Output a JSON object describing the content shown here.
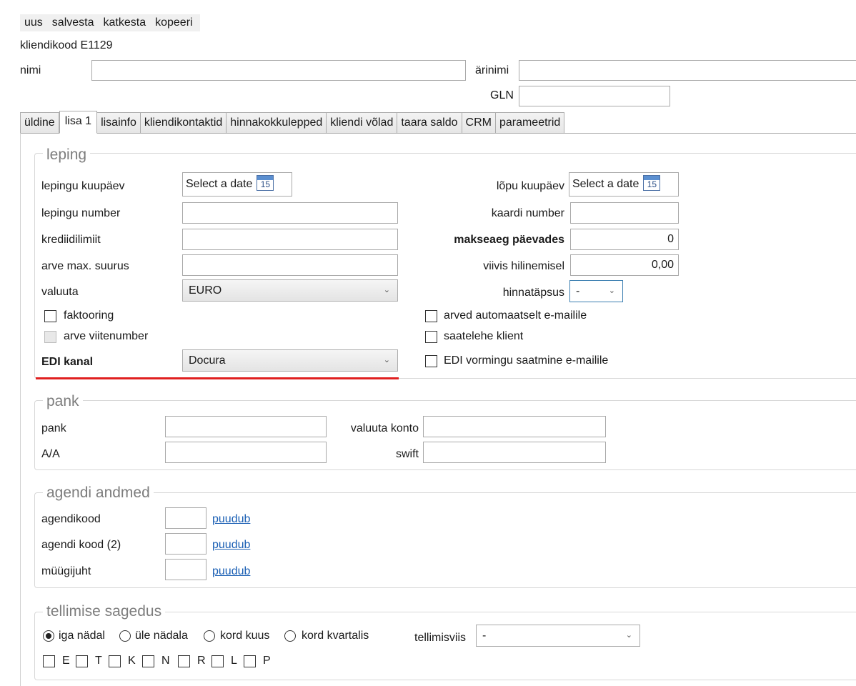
{
  "menu": {
    "new": "uus",
    "save": "salvesta",
    "cancel": "katkesta",
    "copy": "kopeeri"
  },
  "header": {
    "client_code": "kliendikood E1129",
    "name_label": "nimi",
    "name_value": "",
    "business_name_label": "ärinimi",
    "business_name_value": "",
    "gln_label": "GLN",
    "gln_value": ""
  },
  "tabs": [
    "üldine",
    "lisa 1",
    "lisainfo",
    "kliendikontaktid",
    "hinnakokkulepped",
    "kliendi võlad",
    "taara saldo",
    "CRM",
    "parameetrid"
  ],
  "active_tab": "lisa 1",
  "contract": {
    "legend": "leping",
    "start_date_label": "lepingu kuupäev",
    "start_date_placeholder": "Select a date",
    "calendar_day": "15",
    "end_date_label": "lõpu kuupäev",
    "end_date_placeholder": "Select a date",
    "number_label": "lepingu number",
    "number_value": "",
    "card_label": "kaardi number",
    "card_value": "",
    "credit_label": "krediidilimiit",
    "credit_value": "",
    "payment_days_label": "makseaeg päevades",
    "payment_days_value": "0",
    "max_invoice_label": "arve max. suurus",
    "max_invoice_value": "",
    "penalty_label": "viivis hilinemisel",
    "penalty_value": "0,00",
    "currency_label": "valuuta",
    "currency_value": "EURO",
    "price_precision_label": "hinnatäpsus",
    "price_precision_value": "-",
    "factoring_label": "faktooring",
    "invoice_ref_label": "arve viitenumber",
    "auto_email_label": "arved automaatselt e-mailile",
    "waybill_label": "saatelehe klient",
    "edi_label": "EDI kanal",
    "edi_value": "Docura",
    "edi_email_label": "EDI vormingu saatmine e-mailile"
  },
  "bank": {
    "legend": "pank",
    "bank_label": "pank",
    "bank_value": "",
    "currency_account_label": "valuuta konto",
    "currency_account_value": "",
    "account_label": "A/A",
    "account_value": "",
    "swift_label": "swift",
    "swift_value": ""
  },
  "agent": {
    "legend": "agendi andmed",
    "rows": [
      {
        "label": "agendikood",
        "value": "",
        "link": "puudub"
      },
      {
        "label": "agendi kood (2)",
        "value": "",
        "link": "puudub"
      },
      {
        "label": "müügijuht",
        "value": "",
        "link": "puudub"
      }
    ]
  },
  "frequency": {
    "legend": "tellimise sagedus",
    "options": [
      "iga nädal",
      "üle nädala",
      "kord kuus",
      "kord kvartalis"
    ],
    "selected": "iga nädal",
    "order_method_label": "tellimisviis",
    "order_method_value": "-",
    "days": [
      "E",
      "T",
      "K",
      "N",
      "R",
      "L",
      "P"
    ]
  }
}
